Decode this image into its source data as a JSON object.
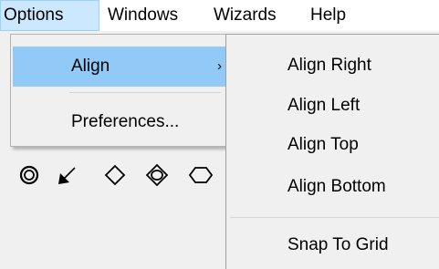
{
  "menubar": {
    "items": [
      {
        "label": "Options"
      },
      {
        "label": "Windows"
      },
      {
        "label": "Wizards"
      },
      {
        "label": "Help"
      }
    ]
  },
  "options_menu": {
    "items": [
      {
        "label": "Align",
        "submenu_indicator": "›"
      },
      {
        "label": "Preferences..."
      }
    ]
  },
  "align_submenu": {
    "items": [
      {
        "label": "Align Right"
      },
      {
        "label": "Align Left"
      },
      {
        "label": "Align Top"
      },
      {
        "label": "Align Bottom"
      },
      {
        "label": "Snap To Grid"
      }
    ]
  },
  "toolbar": {
    "icons": [
      "double-circle-icon",
      "arrow-down-left-icon",
      "diamond-icon",
      "double-diamond-icon",
      "hexagon-icon"
    ]
  },
  "colors": {
    "menubar_bg": "#ffffff",
    "menu_bg": "#f0f0f0",
    "active_title_bg": "#cce8ff",
    "highlight": "#91c9f7"
  }
}
